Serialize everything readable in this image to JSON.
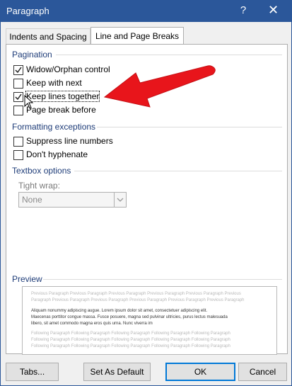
{
  "window": {
    "title": "Paragraph",
    "help_label": "?",
    "close_label": "✕"
  },
  "tabs": [
    {
      "label": "Indents and Spacing",
      "active": false
    },
    {
      "label": "Line and Page Breaks",
      "active": true
    }
  ],
  "pagination": {
    "title": "Pagination",
    "options": [
      {
        "label": "Widow/Orphan control",
        "checked": true
      },
      {
        "label": "Keep with next",
        "checked": false
      },
      {
        "label": "Keep lines together",
        "checked": true
      },
      {
        "label": "Page break before",
        "checked": false
      }
    ]
  },
  "formatting_exceptions": {
    "title": "Formatting exceptions",
    "options": [
      {
        "label": "Suppress line numbers",
        "checked": false
      },
      {
        "label": "Don't hyphenate",
        "checked": false
      }
    ]
  },
  "textbox_options": {
    "title": "Textbox options",
    "tight_wrap_label": "Tight wrap:",
    "tight_wrap_value": "None"
  },
  "preview": {
    "title": "Preview",
    "previous_lines": [
      "Previous Paragraph Previous Paragraph Previous Paragraph Previous Paragraph Previous Paragraph Previous",
      "Paragraph Previous Paragraph Previous Paragraph Previous Paragraph Previous Paragraph Previous Paragraph"
    ],
    "sample_lines": [
      "Aliquam nonummy adipiscing augue. Lorem ipsum dolor sit amet, consectetuer adipiscing elit.",
      "Maecenas porttitor congue massa. Fusce posuere, magna sed pulvinar ultricies, purus lectus malesuada",
      "libero, sit amet commodo magna eros quis urna. Nunc viverra im"
    ],
    "following_lines": [
      "Following Paragraph Following Paragraph Following Paragraph Following Paragraph Following Paragraph",
      "Following Paragraph Following Paragraph Following Paragraph Following Paragraph Following Paragraph",
      "Following Paragraph Following Paragraph Following Paragraph Following Paragraph Following Paragraph"
    ]
  },
  "buttons": {
    "tabs": "Tabs...",
    "set_default": "Set As Default",
    "ok": "OK",
    "cancel": "Cancel"
  },
  "colors": {
    "titlebar": "#2b579a",
    "group_title": "#1e3c78",
    "annotation_arrow": "#e8151b"
  }
}
